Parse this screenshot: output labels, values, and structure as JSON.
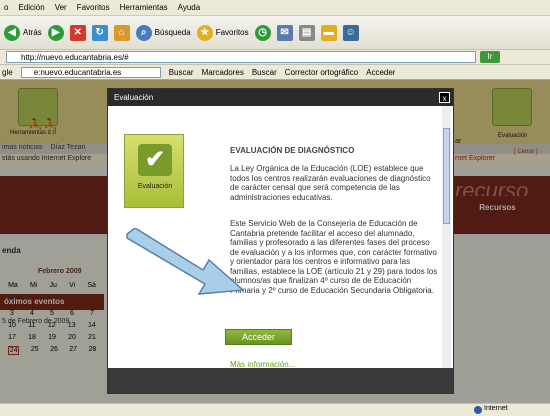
{
  "browser": {
    "menu": [
      "o",
      "Edición",
      "Ver",
      "Favoritos",
      "Herramientas",
      "Ayuda"
    ],
    "toolbar": {
      "back": "Atrás",
      "search": "Búsqueda",
      "favorites": "Favoritos"
    },
    "address": "http://nuevo.educantabria.es/#",
    "go": "Ir",
    "google": {
      "prefix": "gle",
      "search_value": "e:nuevo.educantabria.es",
      "buscar": "Buscar",
      "marcadores": "Marcadores",
      "buscar2": "Buscar",
      "corrector": "Corrector ortográfico",
      "acceder": "Acceder"
    },
    "status": {
      "internet": "Internet"
    }
  },
  "page": {
    "tiles": {
      "herramientas": "Herramientas 2.0",
      "evaluacion": "Evaluación"
    },
    "nav": [
      "imas noticias",
      "Díaz Tezan"
    ],
    "notice": "stás usando Internet Explore",
    "notice_right": "rnet Explorer",
    "close_notice": "[ Cerrar ]",
    "banner_right_text": "recurso",
    "recursos": "Recursos",
    "right_partial": "ar",
    "agenda_title": "enda",
    "calendar": {
      "month": "Febrero 2009",
      "days": [
        "Ma",
        "Mi",
        "Ju",
        "Vi",
        "Sá"
      ],
      "rows": [
        [
          "3",
          "4",
          "5",
          "6",
          "7"
        ],
        [
          "10",
          "11",
          "12",
          "13",
          "14"
        ],
        [
          "17",
          "18",
          "19",
          "20",
          "21"
        ],
        [
          "24",
          "25",
          "26",
          "27",
          "28"
        ]
      ]
    },
    "proximos": "óximos eventos",
    "event_date": "5 de Febrero de 2009"
  },
  "modal": {
    "title": "Evaluación",
    "close": "x",
    "icon_label": "Evaluación",
    "heading": "EVALUACIÓN DE DIAGNÓSTICO",
    "paragraph1": "La Ley Orgánica de la Educación (LOE) establece que todos los centros realizarán evaluaciones de diagnóstico de carácter censal que será competencia de las administraciones educativas.",
    "paragraph2": "Este Servicio Web de la Consejería de Educación de Cantabria pretende facilitar el acceso del alumnado, familias y profesorado a las diferentes fases del proceso de evaluación y a los informes que, con carácter formativo y orientador para los centros e informativo para las familias, establece la LOE (artículo 21 y 29) para todos los alumnos/as que finalizan 4º curso de de Educación Primaria y 2º curso de Educación Secundaria Obligatoria.",
    "acceder": "Acceder",
    "mas_info": "Más información..."
  },
  "colors": {
    "accent": "#7a9a2a",
    "header": "#e9d78a",
    "banner": "#7a2a1e"
  }
}
